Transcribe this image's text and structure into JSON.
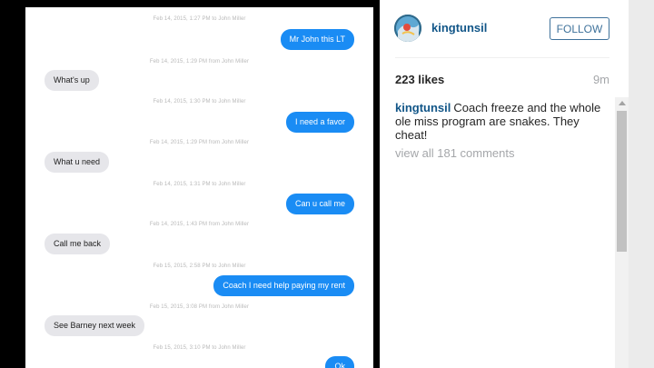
{
  "messages": [
    {
      "timestamp": "Feb 14, 2015, 1:27 PM to John Miller",
      "text": "Mr John this LT",
      "side": "out"
    },
    {
      "timestamp": "Feb 14, 2015, 1:29 PM from John Miller",
      "text": "What's up",
      "side": "in"
    },
    {
      "timestamp": "Feb 14, 2015, 1:30 PM to John Miller",
      "text": "I need a favor",
      "side": "out"
    },
    {
      "timestamp": "Feb 14, 2015, 1:29 PM from John Miller",
      "text": "What u need",
      "side": "in"
    },
    {
      "timestamp": "Feb 14, 2015, 1:31 PM to John Miller",
      "text": "Can u call me",
      "side": "out"
    },
    {
      "timestamp": "Feb 14, 2015, 1:43 PM from John Miller",
      "text": "Call me back",
      "side": "in"
    },
    {
      "timestamp": "Feb 15, 2015, 2:58 PM to John Miller",
      "text": "Coach I need help paying my rent",
      "side": "out"
    },
    {
      "timestamp": "Feb 15, 2015, 3:08 PM from John Miller",
      "text": "See Barney next week",
      "side": "in"
    },
    {
      "timestamp": "Feb 15, 2015, 3:10 PM to John Miller",
      "text": "Ok",
      "side": "out"
    }
  ],
  "post": {
    "username": "kingtunsil",
    "follow_label": "FOLLOW",
    "likes": "223 likes",
    "time_ago": "9m",
    "caption_user": "kingtunsil",
    "caption_text": "Coach freeze and the whole ole miss program are snakes. They cheat!",
    "view_comments": "view all 181 comments"
  },
  "colors": {
    "outgoing_bubble": "#1a8cf4",
    "incoming_bubble": "#e6e6ea",
    "username": "#125688",
    "follow_border": "#3f729b"
  }
}
